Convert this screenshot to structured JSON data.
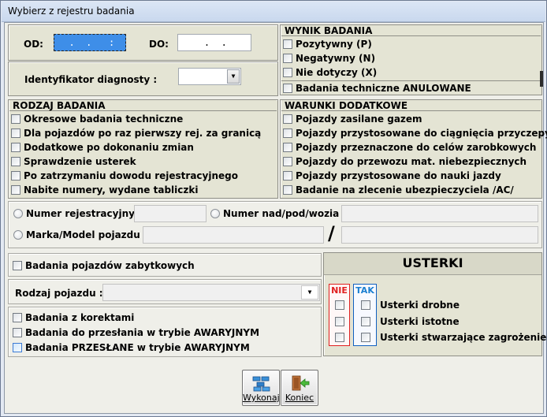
{
  "window": {
    "title": "Wybierz z rejestru badania"
  },
  "dates": {
    "od_label": "OD:",
    "od_value": "  .  .   :  :",
    "do_label": "DO:",
    "do_value": "    .  ."
  },
  "diagnosta": {
    "label": "Identyfikator diagnosty :",
    "value": ""
  },
  "wynik": {
    "header": "WYNIK BADANIA",
    "items": [
      "Pozytywny  (P)",
      "Negatywny  (N)",
      "Nie dotyczy  (X)"
    ],
    "anulowane": "Badania techniczne ANULOWANE"
  },
  "rodzaj": {
    "header": "RODZAJ BADANIA",
    "items": [
      "Okresowe badania techniczne",
      "Dla pojazdów po raz pierwszy rej. za granicą",
      "Dodatkowe po dokonaniu zmian",
      "Sprawdzenie usterek",
      "Po zatrzymaniu dowodu rejestracyjnego",
      "Nabite numery, wydane tabliczki"
    ]
  },
  "warunki": {
    "header": "WARUNKI DODATKOWE",
    "items": [
      "Pojazdy zasilane gazem",
      "Pojazdy przystosowane do ciągnięcia przyczepy",
      "Pojazdy przeznaczone do celów zarobkowych",
      "Pojazdy do przewozu mat. niebezpiecznych",
      "Pojazdy przystosowane do nauki jazdy",
      "Badanie na zlecenie ubezpieczyciela /AC/"
    ]
  },
  "search": {
    "nr_rej_label": "Numer rejestracyjny :",
    "nr_nadwozia_label": "Numer nad/pod/wozia :",
    "marka_label": "Marka/Model pojazdu :",
    "separator": "/"
  },
  "zabytkowe": {
    "label": "Badania pojazdów zabytkowych"
  },
  "rodzaj_pojazdu": {
    "label": "Rodzaj pojazdu :",
    "value": ""
  },
  "extra": {
    "items": [
      "Badania z korektami",
      "Badania do przesłania w trybie AWARYJNYM",
      "Badania PRZESŁANE w trybie AWARYJNYM"
    ]
  },
  "usterki": {
    "title": "USTERKI",
    "nie_label": "NIE",
    "tak_label": "TAK",
    "nie_color": "#e02020",
    "tak_color": "#1060c0",
    "items": [
      "Usterki drobne",
      "Usterki istotne",
      "Usterki stwarzające zagrożenie"
    ]
  },
  "buttons": {
    "wykonaj": "Wykonaj",
    "koniec": "Koniec"
  }
}
